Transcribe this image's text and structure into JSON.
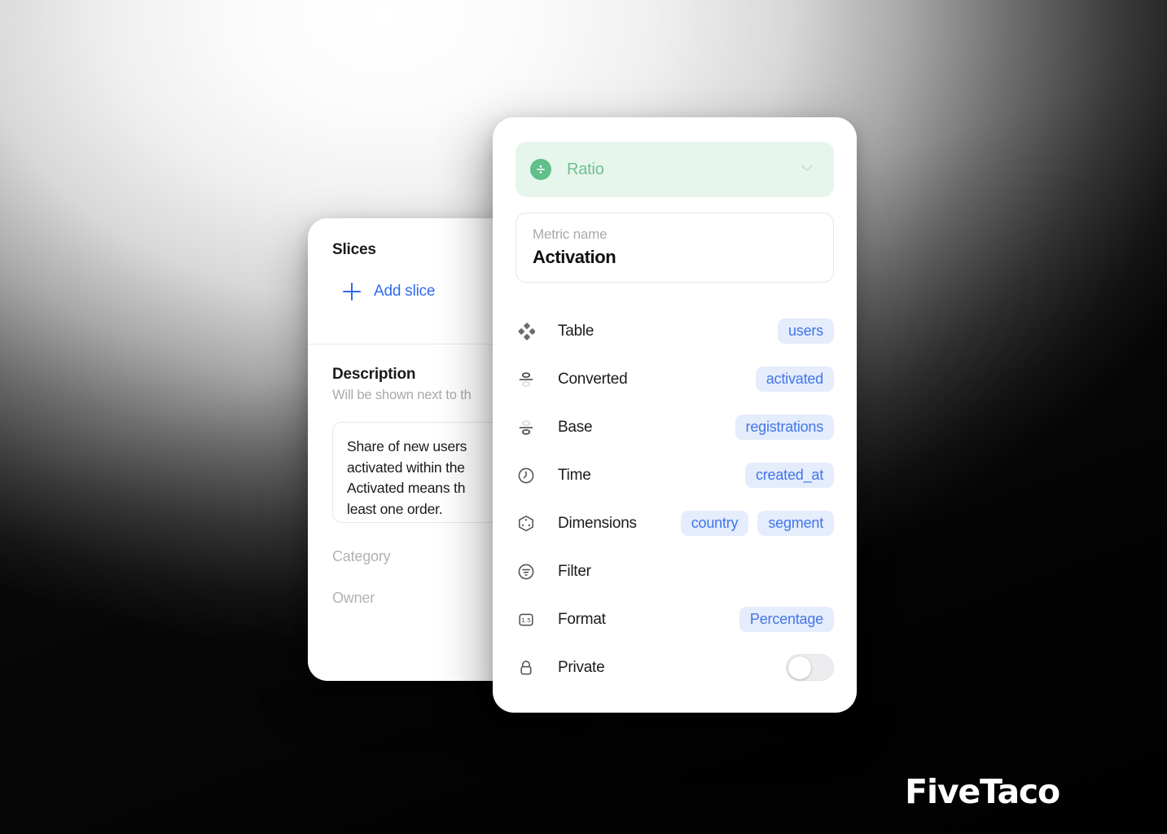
{
  "brand": {
    "logo": "FiveTaco"
  },
  "slices_card": {
    "title": "Slices",
    "add_slice_label": "Add slice",
    "add_slice_icon": "plus-icon",
    "description": {
      "title": "Description",
      "subtitle": "Will be shown next to th",
      "value": "Share of new users \nactivated within the\nActivated means th\nleast one order."
    },
    "meta": {
      "category_label": "Category",
      "owner_label": "Owner"
    }
  },
  "metric_card": {
    "type_selector": {
      "label": "Ratio",
      "icon": "divide-circle-icon",
      "chevron": "chevron-down-icon",
      "bg_color": "#e7f6ec",
      "accent_color": "#61bf8a"
    },
    "name_field": {
      "placeholder": "Metric name",
      "value": "Activation"
    },
    "properties": [
      {
        "label": "Table",
        "icon": "diamonds-grid-icon",
        "values": [
          "users"
        ]
      },
      {
        "label": "Converted",
        "icon": "numerator-icon",
        "values": [
          "activated"
        ]
      },
      {
        "label": "Base",
        "icon": "denominator-icon",
        "values": [
          "registrations"
        ]
      },
      {
        "label": "Time",
        "icon": "clock-icon",
        "values": [
          "created_at"
        ]
      },
      {
        "label": "Dimensions",
        "icon": "cube-icon",
        "values": [
          "country",
          "segment"
        ]
      },
      {
        "label": "Filter",
        "icon": "filter-circle-icon",
        "values": []
      },
      {
        "label": "Format",
        "icon": "decimal-1-5-icon",
        "values": [
          "Percentage"
        ]
      },
      {
        "label": "Private",
        "icon": "lock-icon",
        "values": [],
        "toggle": "off"
      }
    ],
    "pill_bg_color": "#e5ecfb",
    "pill_text_color": "#4176ea"
  }
}
